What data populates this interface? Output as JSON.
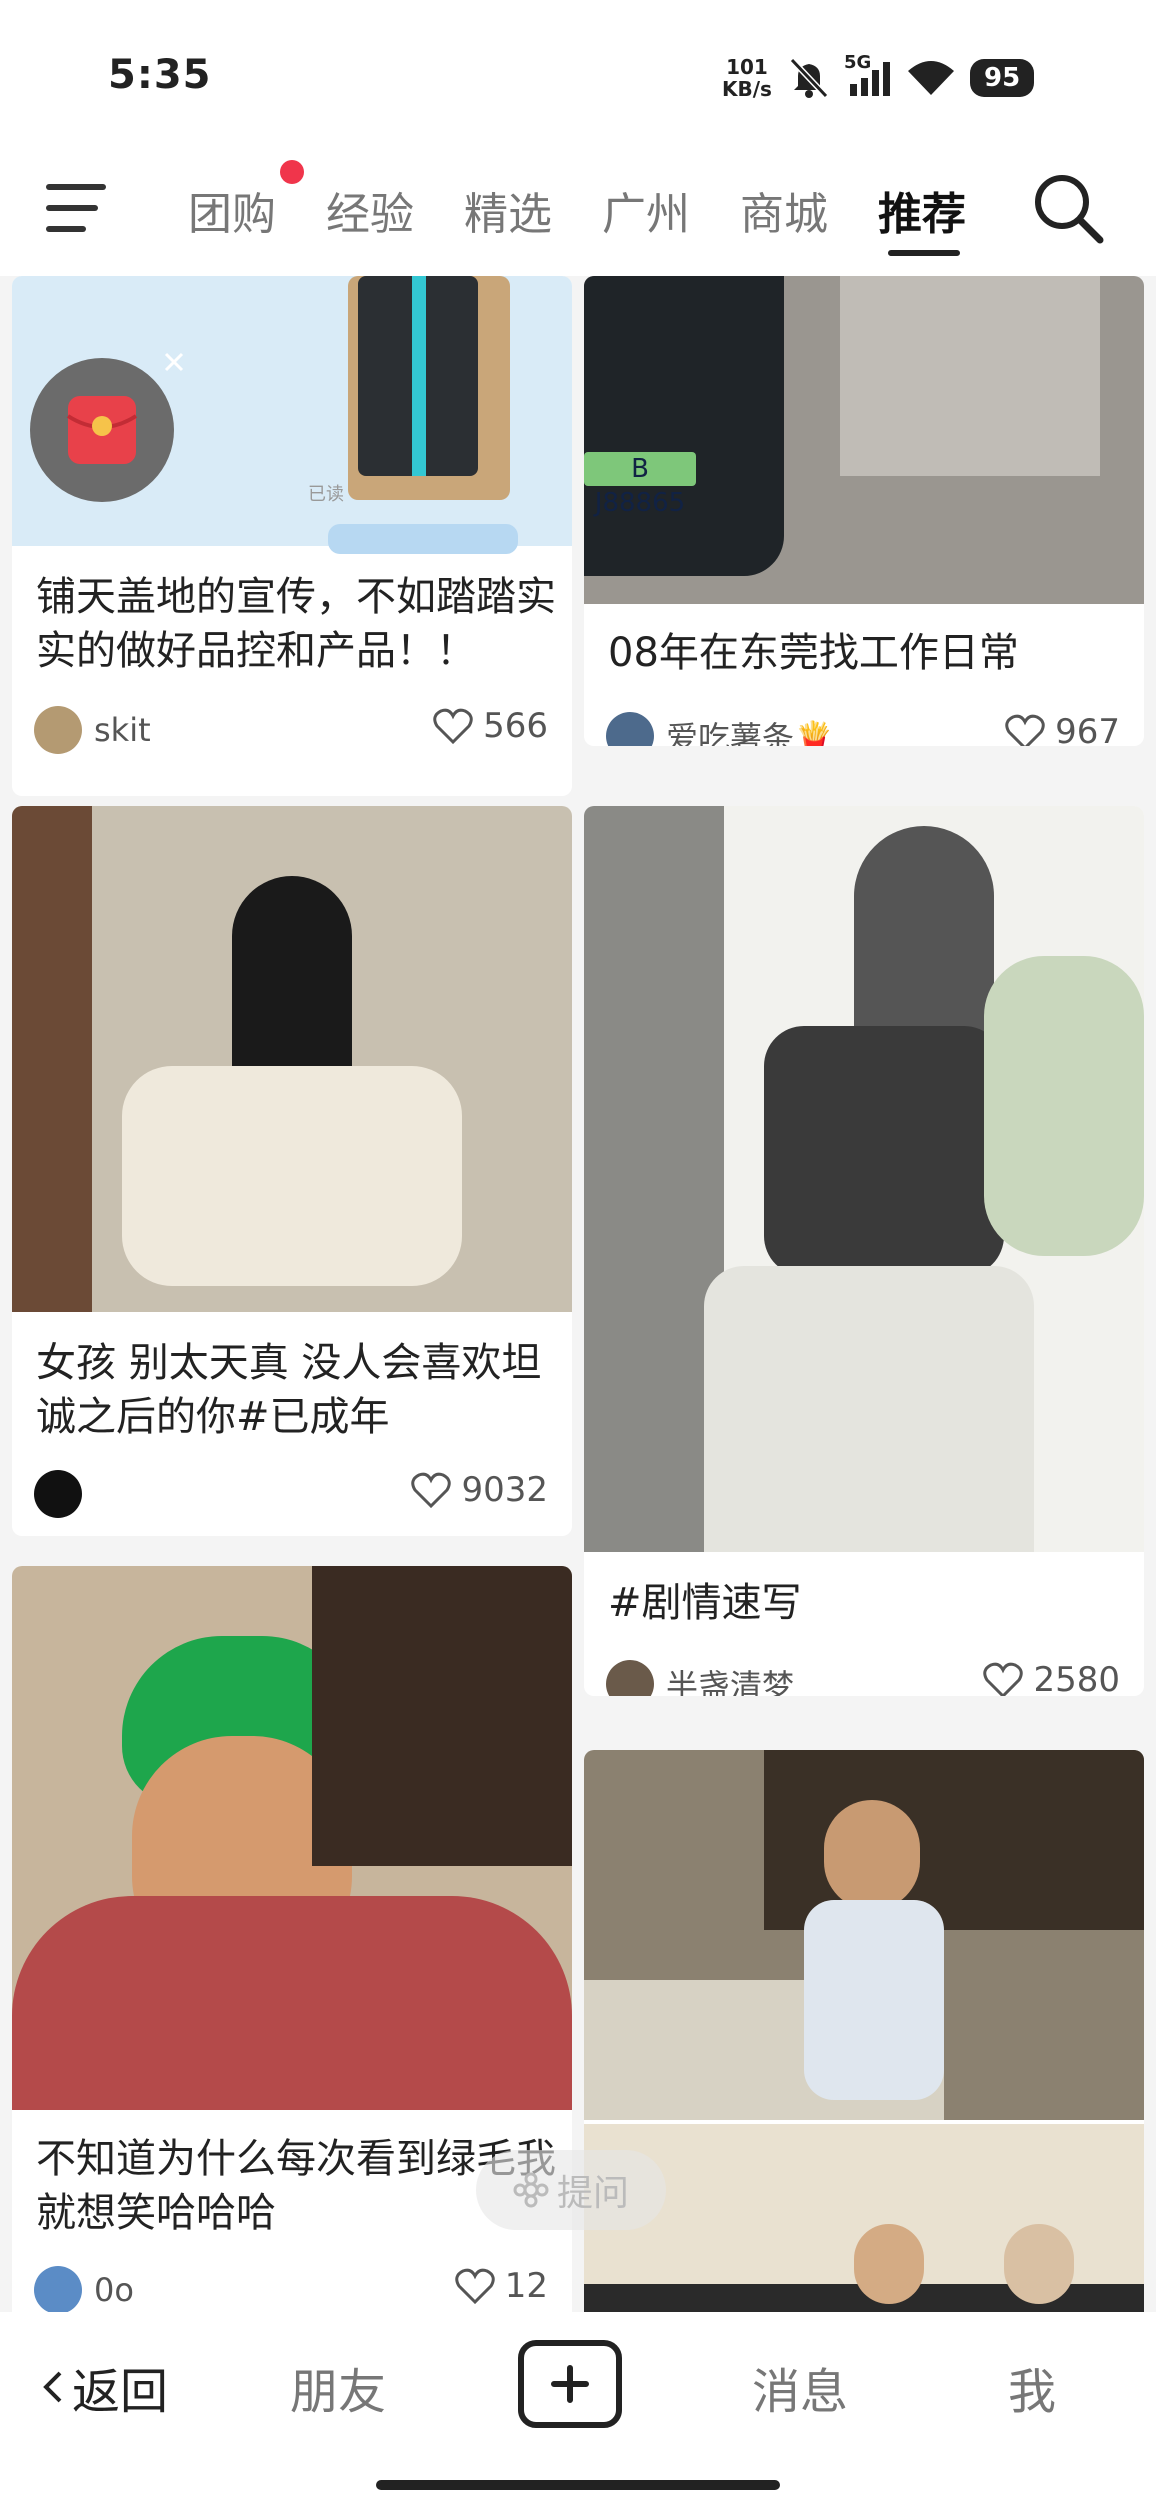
{
  "status": {
    "time": "5:35",
    "net_speed_top": "101",
    "net_speed_bottom": "KB/s",
    "signal": "5G",
    "battery": "95"
  },
  "nav": {
    "tabs": [
      {
        "label": "团购"
      },
      {
        "label": "经验"
      },
      {
        "label": "精选"
      },
      {
        "label": "广州"
      },
      {
        "label": "商城"
      },
      {
        "label": "推荐"
      }
    ],
    "active_tab": "推荐"
  },
  "posts": [
    {
      "title": "铺天盖地的宣传，不如踏踏实实的做好品控和产品！！",
      "author": "skit",
      "likes": "566",
      "image_text": "已读"
    },
    {
      "title": "08年在东莞找工作日常",
      "author": "爱吃薯条🍟",
      "likes": "967",
      "image_text": "B J88865"
    },
    {
      "title": "女孩 别太天真 没人会喜欢坦诚之后的你#已成年",
      "author": "",
      "likes": "9032"
    },
    {
      "title": "#剧情速写",
      "author": "半盏清梦",
      "likes": "2580"
    },
    {
      "title": "不知道为什么每次看到绿毛我就想笑哈哈哈",
      "author": "0o",
      "likes": "12"
    }
  ],
  "floating": {
    "label": "提问"
  },
  "tabbar": {
    "back": "返回",
    "friends": "朋友",
    "messages": "消息",
    "me": "我"
  },
  "colors": {
    "accent_dot": "#f0354b",
    "red_packet": "#e8414a"
  }
}
